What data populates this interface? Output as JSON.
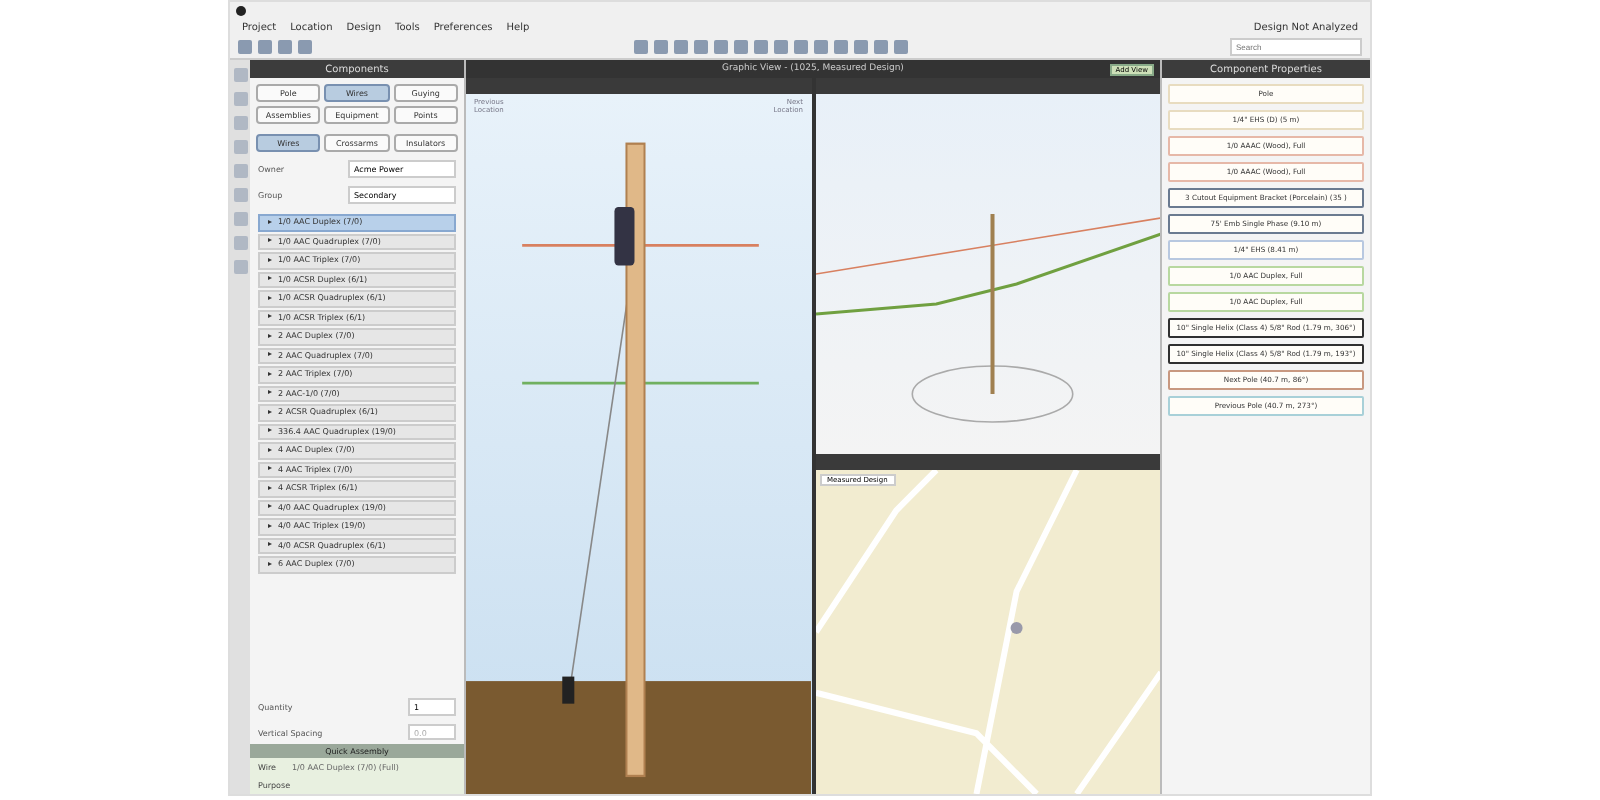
{
  "menu": [
    "Project",
    "Location",
    "Design",
    "Tools",
    "Preferences",
    "Help"
  ],
  "status": "Design Not Analyzed",
  "search": {
    "placeholder": "Search"
  },
  "components": {
    "title": "Components",
    "tabs": [
      {
        "label": "Pole",
        "selected": false
      },
      {
        "label": "Wires",
        "selected": true
      },
      {
        "label": "Guying",
        "selected": false
      },
      {
        "label": "Assemblies",
        "selected": false
      },
      {
        "label": "Equipment",
        "selected": false
      },
      {
        "label": "Points",
        "selected": false
      }
    ],
    "subtabs": [
      {
        "label": "Wires",
        "selected": true
      },
      {
        "label": "Crossarms",
        "selected": false
      },
      {
        "label": "Insulators",
        "selected": false
      }
    ],
    "fields": [
      {
        "label": "Owner",
        "value": "Acme Power"
      },
      {
        "label": "Group",
        "value": "Secondary"
      }
    ],
    "items": [
      {
        "label": "1/0 AAC Duplex (7/0)",
        "selected": true
      },
      {
        "label": "1/0 AAC Quadruplex (7/0)",
        "selected": false
      },
      {
        "label": "1/0 AAC Triplex (7/0)",
        "selected": false
      },
      {
        "label": "1/0 ACSR Duplex (6/1)",
        "selected": false
      },
      {
        "label": "1/0 ACSR Quadruplex (6/1)",
        "selected": false
      },
      {
        "label": "1/0 ACSR Triplex (6/1)",
        "selected": false
      },
      {
        "label": "2 AAC Duplex (7/0)",
        "selected": false
      },
      {
        "label": "2 AAC Quadruplex (7/0)",
        "selected": false
      },
      {
        "label": "2 AAC Triplex (7/0)",
        "selected": false
      },
      {
        "label": "2 AAC-1/0 (7/0)",
        "selected": false
      },
      {
        "label": "2 ACSR Quadruplex (6/1)",
        "selected": false
      },
      {
        "label": "336.4 AAC Quadruplex (19/0)",
        "selected": false
      },
      {
        "label": "4 AAC Duplex (7/0)",
        "selected": false
      },
      {
        "label": "4 AAC Triplex (7/0)",
        "selected": false
      },
      {
        "label": "4 ACSR Triplex (6/1)",
        "selected": false
      },
      {
        "label": "4/0 AAC Quadruplex (19/0)",
        "selected": false
      },
      {
        "label": "4/0 AAC Triplex (19/0)",
        "selected": false
      },
      {
        "label": "4/0 ACSR Quadruplex (6/1)",
        "selected": false
      },
      {
        "label": "6 AAC Duplex (7/0)",
        "selected": false
      }
    ],
    "quantity": {
      "label": "Quantity",
      "value": "1"
    },
    "spacing": {
      "label": "Vertical Spacing",
      "placeholder": "0.0"
    },
    "quick": {
      "title": "Quick Assembly",
      "label": "Wire",
      "value": "1/0 AAC Duplex (7/0) (Full)",
      "purpose": "Purpose"
    }
  },
  "graphic": {
    "title": "Graphic View - (1025, Measured Design)",
    "add": "Add View",
    "previous": "Previous Location",
    "next": "Next Location",
    "map_layer": "Measured Design"
  },
  "properties": {
    "title": "Component Properties",
    "items": [
      {
        "label": "Pole",
        "color": "#e8dcc0"
      },
      {
        "label": "1/4\" EHS (D) (5 m)",
        "color": "#e8dcc0"
      },
      {
        "label": "1/0 AAAC (Wood), Full",
        "color": "#e6b8a8"
      },
      {
        "label": "1/0 AAAC (Wood), Full",
        "color": "#e6b8a8"
      },
      {
        "label": "3 Cutout Equipment Bracket (Porcelain) (35 )",
        "color": "#6a7a90"
      },
      {
        "label": "75' Emb Single Phase (9.10 m)",
        "color": "#6a7a90"
      },
      {
        "label": "1/4\" EHS (8.41 m)",
        "color": "#b8c8e0"
      },
      {
        "label": "1/0 AAC Duplex, Full",
        "color": "#b8d8a0"
      },
      {
        "label": "1/0 AAC Duplex, Full",
        "color": "#b8d8a0"
      },
      {
        "label": "10\" Single Helix (Class 4) 5/8\" Rod (1.79 m, 306°)",
        "color": "#303030"
      },
      {
        "label": "10\" Single Helix (Class 4) 5/8\" Rod (1.79 m, 193°)",
        "color": "#303030"
      },
      {
        "label": "Next Pole (40.7 m, 86°)",
        "color": "#c89880"
      },
      {
        "label": "Previous Pole (40.7 m, 273°)",
        "color": "#a8d0d8"
      }
    ]
  }
}
